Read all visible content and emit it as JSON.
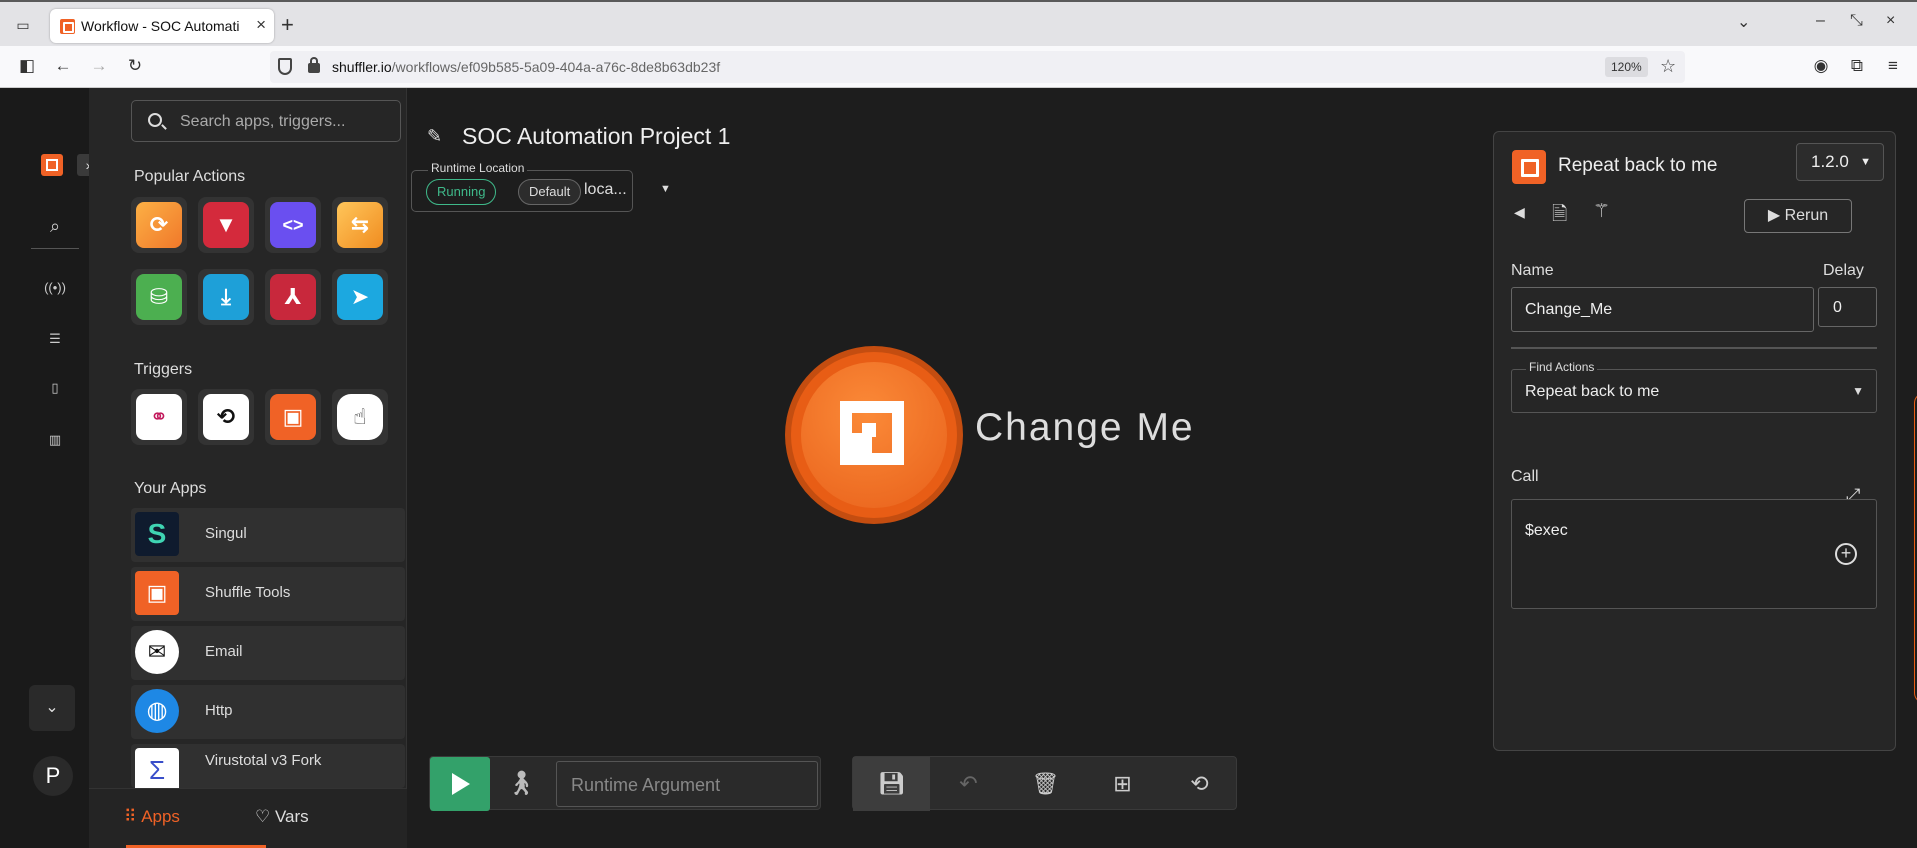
{
  "browser": {
    "tab_title": "Workflow - SOC Automati",
    "url_host": "shuffler.io",
    "url_path": "/workflows/ef09b585-5a09-404a-a76c-8de8b63db23f",
    "zoom": "120%"
  },
  "sidebar": {
    "search_placeholder": "Search apps, triggers...",
    "popular_actions_title": "Popular Actions",
    "triggers_title": "Triggers",
    "your_apps_title": "Your Apps",
    "apps": [
      {
        "name": "Singul"
      },
      {
        "name": "Shuffle Tools"
      },
      {
        "name": "Email"
      },
      {
        "name": "Http"
      },
      {
        "name": "Virustotal v3 Fork"
      }
    ],
    "tab_apps": "Apps",
    "tab_vars": "Vars",
    "avatar_letter": "P"
  },
  "workflow": {
    "title": "SOC Automation Project 1",
    "runtime_label": "Runtime Location",
    "status_chip": "Running",
    "default_chip": "Default",
    "location": "loca...",
    "node_label": "Change Me",
    "runtime_argument_placeholder": "Runtime Argument"
  },
  "action_panel": {
    "title": "Repeat back to me",
    "version": "1.2.0",
    "rerun_label": "Rerun",
    "name_label": "Name",
    "name_value": "Change_Me",
    "delay_label": "Delay",
    "delay_value": "0",
    "find_actions_label": "Find Actions",
    "find_actions_value": "Repeat back to me",
    "call_label": "Call",
    "call_value": "$exec"
  },
  "colors": {
    "accent": "#f06226",
    "running": "#3fb98a",
    "play": "#33a16a"
  }
}
